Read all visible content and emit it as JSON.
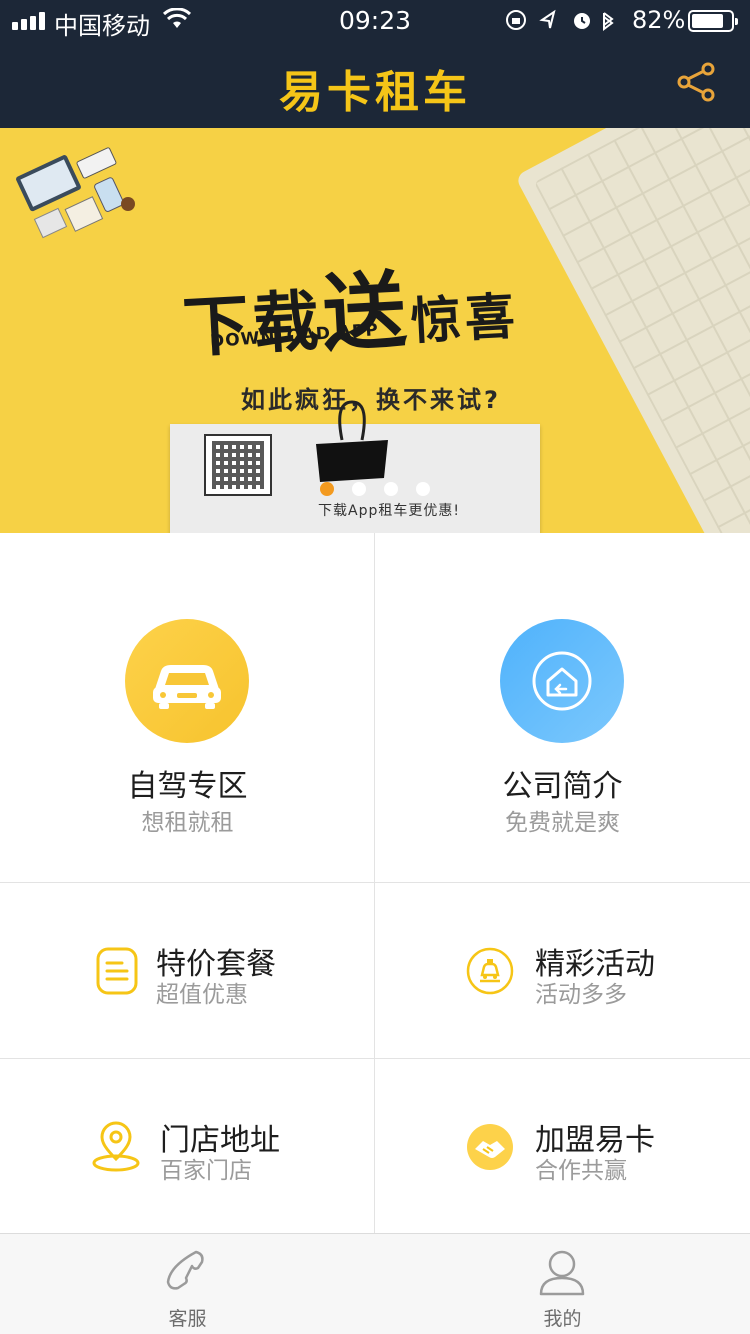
{
  "status_bar": {
    "carrier": "中国移动",
    "time": "09:23",
    "battery_pct": "82%",
    "battery_level": 0.82,
    "signal_bars": 4
  },
  "nav": {
    "title": "易卡租车",
    "share_icon": "share-icon",
    "title_color": "#f5c518",
    "background": "#1c2737"
  },
  "banner": {
    "headline_1": "下载",
    "headline_2": "送",
    "headline_3": "惊喜",
    "english": "DOWNLOAD APP",
    "subline": "如此疯狂，换不来试?",
    "paper_text": "下载App租车更优惠!",
    "background": "#f6d145",
    "slides": 4,
    "active_slide": 0
  },
  "menu": {
    "self_drive": {
      "title": "自驾专区",
      "subtitle": "想租就租",
      "icon": "car-icon"
    },
    "company": {
      "title": "公司简介",
      "subtitle": "免费就是爽",
      "icon": "home-icon"
    },
    "packages": {
      "title": "特价套餐",
      "subtitle": "超值优惠",
      "icon": "list-icon"
    },
    "activities": {
      "title": "精彩活动",
      "subtitle": "活动多多",
      "icon": "taxi-icon"
    },
    "stores": {
      "title": "门店地址",
      "subtitle": "百家门店",
      "icon": "location-icon"
    },
    "franchise": {
      "title": "加盟易卡",
      "subtitle": "合作共赢",
      "icon": "handshake-icon"
    }
  },
  "tabbar": {
    "service": {
      "label": "客服",
      "icon": "phone-icon"
    },
    "mine": {
      "label": "我的",
      "icon": "user-icon"
    }
  },
  "colors": {
    "accent_yellow": "#f5c518",
    "accent_blue": "#4fb2fb",
    "dot_active": "#f39a1f"
  }
}
